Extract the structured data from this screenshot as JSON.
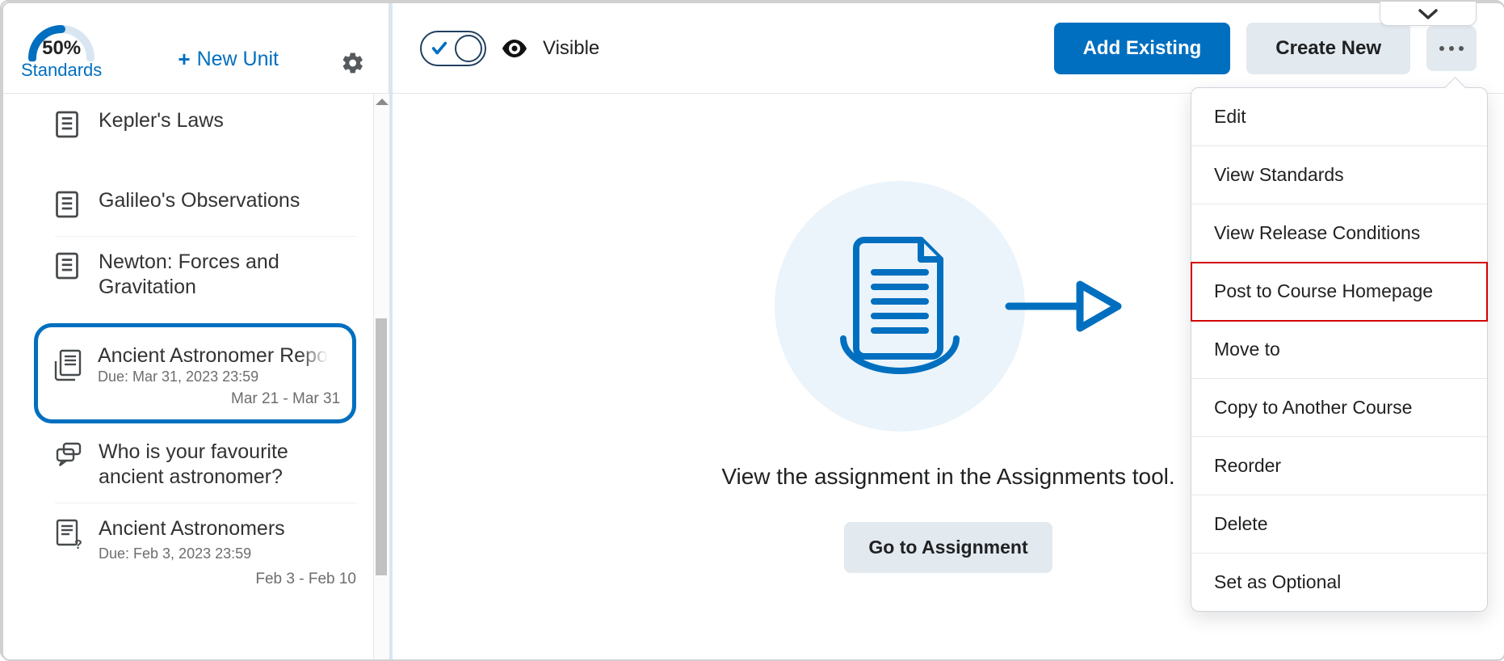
{
  "sidebar": {
    "standards_pct": "50%",
    "standards_label": "Standards",
    "new_unit_label": "New Unit",
    "items": [
      {
        "title": "Kepler's Laws"
      },
      {
        "title": "Galileo's Observations"
      },
      {
        "title": "Newton: Forces and Gravitation"
      },
      {
        "title": "Ancient Astronomer Report",
        "due": "Due: Mar 31, 2023 23:59",
        "range": "Mar 21 - Mar 31"
      },
      {
        "title": "Who is your favourite ancient astronomer?"
      },
      {
        "title": "Ancient Astronomers",
        "due": "Due: Feb 3, 2023 23:59",
        "range": "Feb 3 - Feb 10"
      }
    ]
  },
  "header": {
    "visible_label": "Visible",
    "add_existing": "Add Existing",
    "create_new": "Create New"
  },
  "main": {
    "message": "View the assignment in the Assignments tool.",
    "go_button": "Go to Assignment"
  },
  "menu": [
    "Edit",
    "View Standards",
    "View Release Conditions",
    "Post to Course Homepage",
    "Move to",
    "Copy to Another Course",
    "Reorder",
    "Delete",
    "Set as Optional"
  ],
  "menu_highlight_index": 3
}
